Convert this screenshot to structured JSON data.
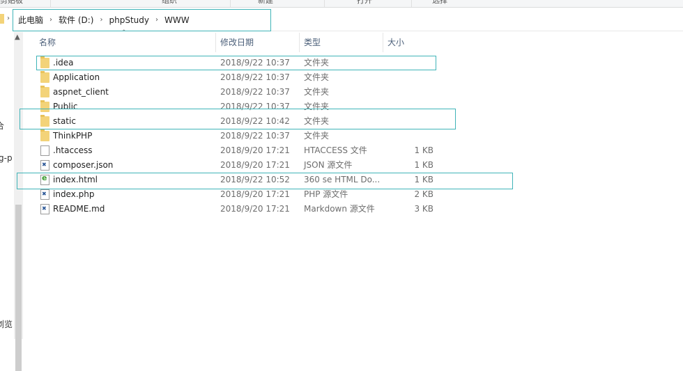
{
  "ribbon": {
    "captions": [
      "剪贴板",
      "组织",
      "新建",
      "打开",
      "选择"
    ]
  },
  "breadcrumb": {
    "items": [
      "此电脑",
      "软件 (D:)",
      "phpStudy",
      "WWW"
    ]
  },
  "left_pane": {
    "fragments": [
      "合",
      "g-p",
      "浏览"
    ]
  },
  "columns": {
    "name": "名称",
    "date": "修改日期",
    "type": "类型",
    "size": "大小"
  },
  "files": [
    {
      "name": ".idea",
      "date": "2018/9/22 10:37",
      "type": "文件夹",
      "size": "",
      "icon": "folder-icon"
    },
    {
      "name": "Application",
      "date": "2018/9/22 10:37",
      "type": "文件夹",
      "size": "",
      "icon": "folder-icon"
    },
    {
      "name": "aspnet_client",
      "date": "2018/9/22 10:37",
      "type": "文件夹",
      "size": "",
      "icon": "folder-icon"
    },
    {
      "name": "Public",
      "date": "2018/9/22 10:37",
      "type": "文件夹",
      "size": "",
      "icon": "folder-icon"
    },
    {
      "name": "static",
      "date": "2018/9/22 10:42",
      "type": "文件夹",
      "size": "",
      "icon": "folder-icon"
    },
    {
      "name": "ThinkPHP",
      "date": "2018/9/22 10:37",
      "type": "文件夹",
      "size": "",
      "icon": "folder-icon"
    },
    {
      "name": ".htaccess",
      "date": "2018/9/20 17:21",
      "type": "HTACCESS 文件",
      "size": "1 KB",
      "icon": "blank-file-icon"
    },
    {
      "name": "composer.json",
      "date": "2018/9/20 17:21",
      "type": "JSON 源文件",
      "size": "1 KB",
      "icon": "code-file-icon"
    },
    {
      "name": "index.html",
      "date": "2018/9/22 10:52",
      "type": "360 se HTML Do...",
      "size": "1 KB",
      "icon": "browser-file-icon"
    },
    {
      "name": "index.php",
      "date": "2018/9/20 17:21",
      "type": "PHP 源文件",
      "size": "2 KB",
      "icon": "code-file-icon"
    },
    {
      "name": "README.md",
      "date": "2018/9/20 17:21",
      "type": "Markdown 源文件",
      "size": "3 KB",
      "icon": "code-file-icon"
    }
  ],
  "colors": {
    "highlight": "#3fb4b8",
    "folder": "#f3d379",
    "header_text": "#4c607a"
  }
}
